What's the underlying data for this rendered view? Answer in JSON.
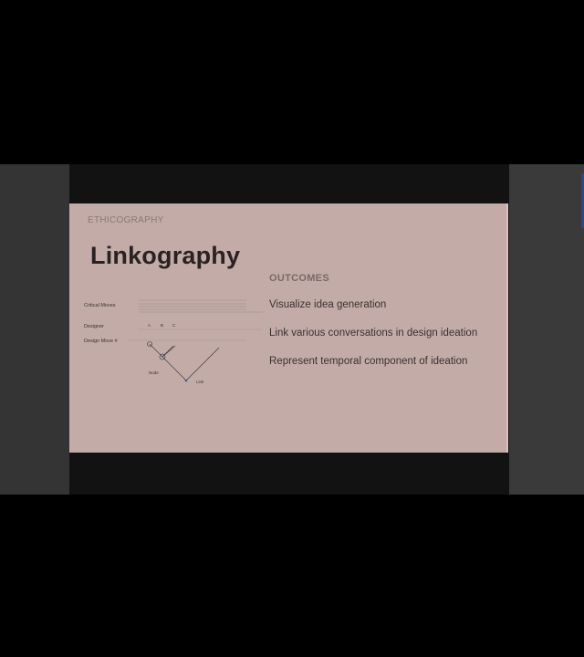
{
  "slide": {
    "eyebrow": "ETHICOGRAPHY",
    "title": "Linkography",
    "diagram": {
      "critical_moves_label": "Critical Moves",
      "designer_label": "Designer",
      "designer_columns": [
        "A",
        "B",
        "C"
      ],
      "design_move_label": "Design Move #",
      "node_label": "Node",
      "link_label": "Link"
    },
    "outcomes": {
      "heading": "OUTCOMES",
      "items": [
        "Visualize idea generation",
        "Link various conversations in design ideation",
        "Represent temporal component of ideation"
      ]
    }
  },
  "colors": {
    "background": "#000000",
    "slide_background": "#c3aca8",
    "title_text": "#2a2222"
  }
}
